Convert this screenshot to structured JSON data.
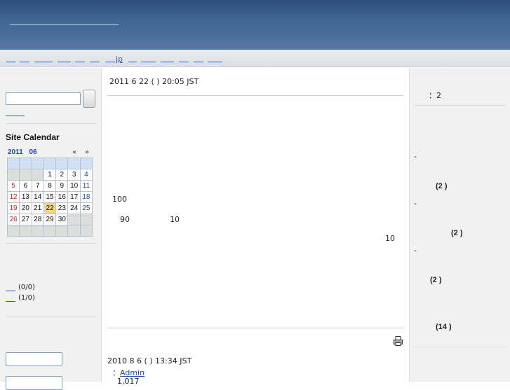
{
  "nav": {
    "jp_label": "jp"
  },
  "calendar": {
    "title": "Site Calendar",
    "year_month": "2011 06",
    "prev": "«",
    "next": "»",
    "weeks": [
      [
        "",
        "",
        "",
        "1",
        "2",
        "3",
        "4"
      ],
      [
        "5",
        "6",
        "7",
        "8",
        "9",
        "10",
        "11"
      ],
      [
        "12",
        "13",
        "14",
        "15",
        "16",
        "17",
        "18"
      ],
      [
        "19",
        "20",
        "21",
        "22",
        "23",
        "24",
        "25"
      ],
      [
        "26",
        "27",
        "28",
        "29",
        "30",
        "",
        ""
      ]
    ],
    "today": "22"
  },
  "left_counts": [
    "(0/0)",
    "(1/0)"
  ],
  "article1": {
    "date": "2011 6 22 ( ) 20:05 JST",
    "line1": "100",
    "line2a": "90",
    "line2b": "10",
    "line3": "10"
  },
  "article2": {
    "date": "2010 8  6 ( ) 13:34 JST",
    "author_prefix": "：",
    "author": "Admin",
    "views": "1,017"
  },
  "right": {
    "top_stat": "：2",
    "dashes": [
      "-",
      "-",
      "-"
    ],
    "counts": [
      "(2 )",
      "(2 )",
      "(2 )",
      "(14 )"
    ]
  }
}
